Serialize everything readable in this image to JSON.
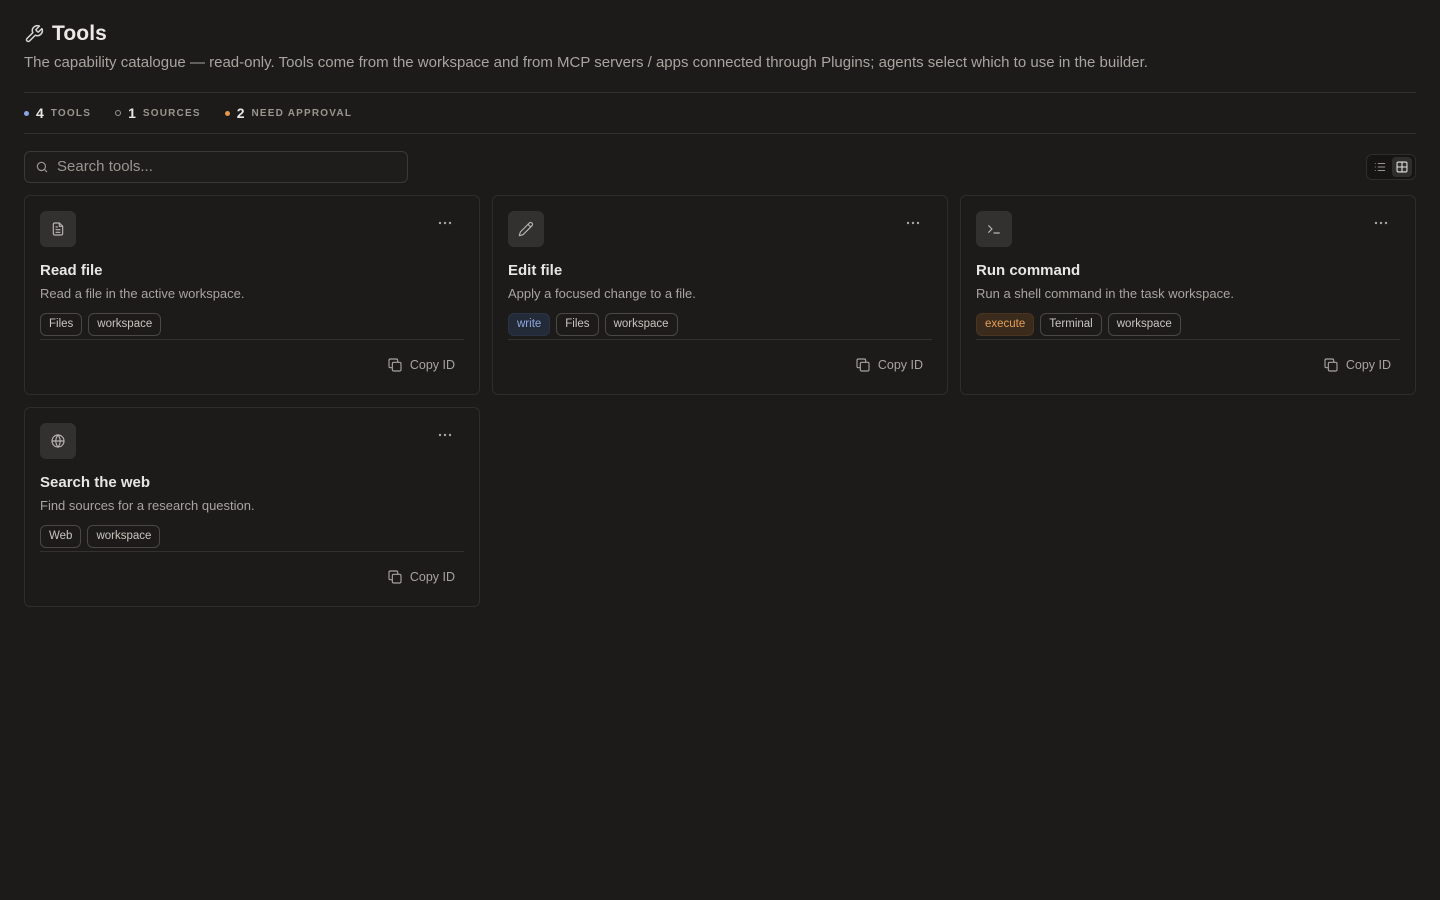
{
  "header": {
    "title": "Tools",
    "subtitle": "The capability catalogue — read-only. Tools come from the workspace and from MCP servers / apps connected through Plugins; agents select which to use in the builder."
  },
  "stats": [
    {
      "value": "4",
      "label": "TOOLS",
      "dot": "#8aa4e6"
    },
    {
      "value": "1",
      "label": "SOURCES",
      "dot": "hollow"
    },
    {
      "value": "2",
      "label": "NEED APPROVAL",
      "dot": "#e3964c"
    }
  ],
  "search": {
    "placeholder": "Search tools..."
  },
  "view_toggle": {
    "active": "grid"
  },
  "tools": [
    {
      "name": "Read file",
      "description": "Read a file in the active workspace.",
      "icon": "file-text-icon",
      "tags": [
        {
          "label": "Files",
          "kind": "plain"
        },
        {
          "label": "workspace",
          "kind": "plain"
        }
      ],
      "copy_label": "Copy ID"
    },
    {
      "name": "Edit file",
      "description": "Apply a focused change to a file.",
      "icon": "pencil-icon",
      "tags": [
        {
          "label": "write",
          "kind": "write"
        },
        {
          "label": "Files",
          "kind": "plain"
        },
        {
          "label": "workspace",
          "kind": "plain"
        }
      ],
      "copy_label": "Copy ID"
    },
    {
      "name": "Run command",
      "description": "Run a shell command in the task workspace.",
      "icon": "terminal-icon",
      "tags": [
        {
          "label": "execute",
          "kind": "execute"
        },
        {
          "label": "Terminal",
          "kind": "plain"
        },
        {
          "label": "workspace",
          "kind": "plain"
        }
      ],
      "copy_label": "Copy ID"
    },
    {
      "name": "Search the web",
      "description": "Find sources for a research question.",
      "icon": "globe-icon",
      "tags": [
        {
          "label": "Web",
          "kind": "plain"
        },
        {
          "label": "workspace",
          "kind": "plain"
        }
      ],
      "copy_label": "Copy ID"
    }
  ]
}
